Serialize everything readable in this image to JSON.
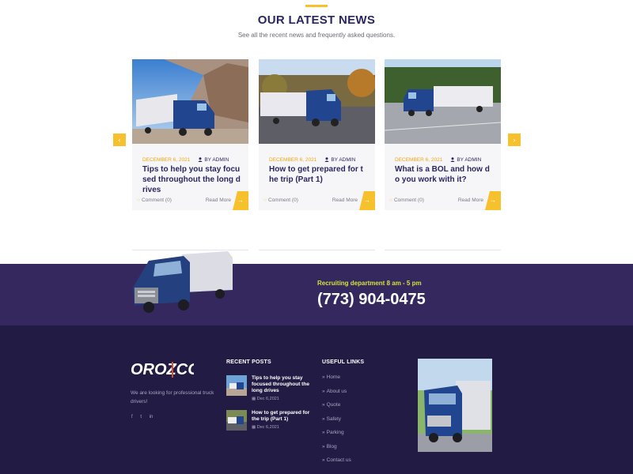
{
  "news": {
    "title": "OUR LATEST NEWS",
    "subtitle": "See all the recent news and frequently asked questions.",
    "prev_icon": "‹",
    "next_icon": "›",
    "cards": [
      {
        "date": "DECEMBER 6, 2021",
        "author": "BY ADMIN",
        "title": "Tips to help you stay focused throughout the long drives",
        "comments": "Comment (0)",
        "read_more": "Read More"
      },
      {
        "date": "DECEMBER 6, 2021",
        "author": "BY ADMIN",
        "title": "How to get prepared for the trip (Part 1)",
        "comments": "Comment (0)",
        "read_more": "Read More"
      },
      {
        "date": "DECEMBER 6, 2021",
        "author": "BY ADMIN",
        "title": "What is a BOL and how do you work with it?",
        "comments": "Comment (0)",
        "read_more": "Read More"
      }
    ]
  },
  "cta": {
    "hours": "Recruiting department 8 am - 5 pm",
    "phone": "(773) 904-0475"
  },
  "footer": {
    "logo_text": "OROZCO",
    "about": "We are looking for professional truck drivers!",
    "socials": [
      "f",
      "t",
      "in"
    ],
    "recent_posts_title": "RECENT POSTS",
    "recent_posts": [
      {
        "title": "Tips to help you stay focused throughout the long drives",
        "date": "Dec 6,2021"
      },
      {
        "title": "How to get prepared for the trip (Part 1)",
        "date": "Dec 6,2021"
      }
    ],
    "useful_links_title": "USEFUL LINKS",
    "links": [
      "Home",
      "About us",
      "Quote",
      "Safety",
      "Parking",
      "Blog",
      "Contact us"
    ]
  },
  "colors": {
    "accent": "#f7c12d",
    "navy": "#2b2660",
    "cta_bg": "#35285f",
    "footer_bg": "#221c44",
    "cta_highlight": "#d4e339"
  }
}
